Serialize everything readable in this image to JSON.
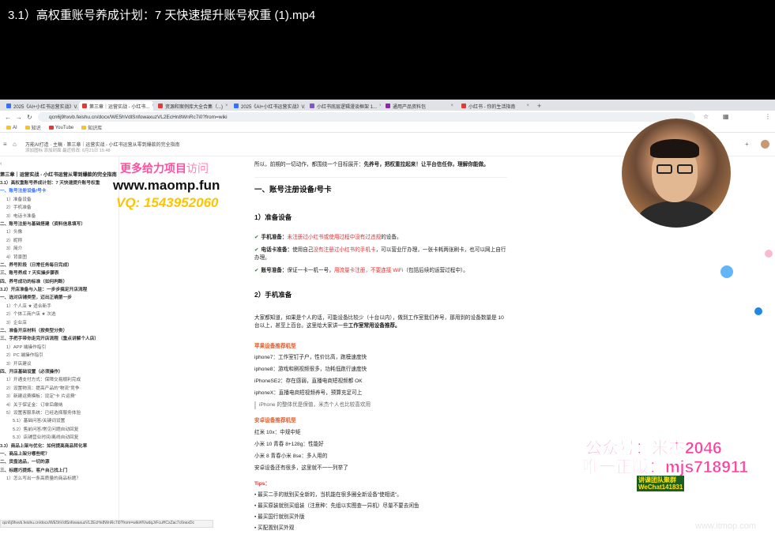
{
  "video_title": "3.1）高权重账号养成计划：7 天快速提升账号权重 (1).mp4",
  "tabs": [
    {
      "label": "2025《AI+小红书运营实战》V..."
    },
    {
      "label": "第三章｜运营实战 - 小红书..."
    },
    {
      "label": "资源和案例库大全合集（...)"
    },
    {
      "label": "2025《AI+小红书运营实战》V..."
    },
    {
      "label": "小红书底层逻辑漫谈框架 1..."
    },
    {
      "label": "通用产品资料包"
    },
    {
      "label": "小红书 - 你的生活指南"
    }
  ],
  "url": "qcn6j9hxvb.feishu.cn/docx/WE5hVdlSnfowaxuzVL2EcHn8WnRc7i0?from=wiki",
  "bookmarks": [
    "AI",
    "知识",
    "YouTube",
    "知识库"
  ],
  "doc_header": {
    "breadcrumb": "万能AI打造  ·  主稿  ·  第三章｜运营实战 - 小红书运营从零到爆款的完全指南",
    "meta": "添加图标  添加封面  最近修改: 6月21日 15:48"
  },
  "toc": {
    "heading": "第三章｜运营实战 - 小红书运营从零到爆款的完全指南",
    "items": [
      {
        "t": "3.1）高权重账号养成计划：7 天快速提升账号权重",
        "l": 1
      },
      {
        "t": "一、账号注册设备/号卡",
        "l": 1,
        "cur": true
      },
      {
        "t": "1）准备设备",
        "l": 2
      },
      {
        "t": "2）手机准备",
        "l": 2
      },
      {
        "t": "3）电话卡准备",
        "l": 2
      },
      {
        "t": "二、账号注册与基础搭建（资料信息填写）",
        "l": 1
      },
      {
        "t": "1）头像",
        "l": 2
      },
      {
        "t": "2）昵称",
        "l": 2
      },
      {
        "t": "3）简介",
        "l": 2
      },
      {
        "t": "4）背景图",
        "l": 2
      },
      {
        "t": "二、养号阶段（日常任务每日完成）",
        "l": 1
      },
      {
        "t": "三、账号养成 7 天实操步骤表",
        "l": 1
      },
      {
        "t": "四、养号成功的标准（如何判断）",
        "l": 1
      },
      {
        "t": "3.2）开店准备与入驻：一步步搞定开店流程",
        "l": 1
      },
      {
        "t": "一、选对店铺类型，迈出正确第一步",
        "l": 1
      },
      {
        "t": "1）个人店 ★ 适合新手",
        "l": 2
      },
      {
        "t": "2）个体工商户店 ★ 次选",
        "l": 2
      },
      {
        "t": "3）企业店",
        "l": 2
      },
      {
        "t": "二、准备开店材料（按类型分类）",
        "l": 1
      },
      {
        "t": "三、手把手带你走完开店流程（重点讲解个人店）",
        "l": 1
      },
      {
        "t": "1）APP 端操作指引",
        "l": 2
      },
      {
        "t": "2）PC 端操作指引",
        "l": 2
      },
      {
        "t": "3）开店建议",
        "l": 2
      },
      {
        "t": "四、开店基础设置（必须操作）",
        "l": 1
      },
      {
        "t": "1）开通支付方式：保障交易顺利完成",
        "l": 2
      },
      {
        "t": "2）设置物流：提高产品的\"物流\"竞争",
        "l": 2
      },
      {
        "t": "3）新建运费模板：设定\"卡 片运费\"",
        "l": 2
      },
      {
        "t": "4）关于保证金：订单后缴纳",
        "l": 2
      },
      {
        "t": "5）设置客服系统：已经选择服务体验",
        "l": 2
      },
      {
        "t": "5.1）基础问答/关键词设置",
        "l": 3
      },
      {
        "t": "5.2）售前问答/常见问题自动回复",
        "l": 3
      },
      {
        "t": "5.3）店铺营业时间/离线自动回复",
        "l": 3
      },
      {
        "t": "3.3）商品上架与优化：如何提高商品转化率",
        "l": 1
      },
      {
        "t": "一、商品上架分哪些呢？",
        "l": 1
      },
      {
        "t": "二、货盘选品，一切的源",
        "l": 1
      },
      {
        "t": "三、标题巧提炼，客户自己找上门",
        "l": 1
      },
      {
        "t": "1）怎么写出一条高质量的商品标题？",
        "l": 2
      }
    ]
  },
  "watermark_left": {
    "line1a": "更多给力项目",
    "line1b": "访问",
    "line2": "www.maomp.fun",
    "line3": "VQ: 1543952060"
  },
  "content": {
    "intro": "所以，前期的一切动作，都围绕一个目标展开：",
    "intro_b": "先养号，把权重拉起来！让平台信任你，理解你能做。",
    "h1": "一、账号注册设备/号卡",
    "h2a": "1）准备设备",
    "b1k": "手机准备：",
    "b1r": "未注册过小红书或使用过程中没有过违规",
    "b1e": "的设备。",
    "b2k": "电话卡准备：",
    "b2a": "使用自己",
    "b2r": "没有注册过小红书的手机卡",
    "b2e": "，可以营业厅办理，一张卡耗两张刷卡，也可以网上自行",
    "b2f": "办理。",
    "b3k": "账号准备：",
    "b3a": "保证一卡一机一号，",
    "b3r": "用流量卡注册，不要连接 WiFi",
    "b3e": "（包括后续的运营过程中）。",
    "h2b": "2）手机准备",
    "p1": "大家都知道，如果是个人的话，可能设备比较少（十台以内），做到工作室我们养号，那用到的设备数量是 10",
    "p2a": "台以上，甚至上百台。这里给大家讲一些",
    "p2b": "工作室常用设备推荐。",
    "sh1": "苹果设备推荐机型",
    "ios": [
      "iphone7：工作室钉子户，性价比高，跑模速度快",
      "iphone8：游戏和刷视频很多，功耗低跑行速度快",
      "iPhoneSE2：存在感弱，直播电商短视频都 OK",
      "iphoneX：直播电商短视频养号，预算充足可上"
    ],
    "quote": "iPhone 的整体优是保值，米杰个人也比较喜欢用",
    "sh2": "安卓设备推荐机型",
    "android": [
      "红米 10x：中规中矩",
      "小米 10 青春 8+128g：性能好",
      "小米 8 青春小米 8se：多人用的",
      "安卓设备还有很多，这里就不一一列举了"
    ],
    "sh3": "Tips：",
    "tips": [
      "最买二手的就别买全新的，当机能在很多圈全新设备\"使相说\"。",
      "最买原装就别买组装（注意种：先组以实图查一异机）尽量不要去闲鱼",
      "最买国行就别买外版",
      "买配置别买外观",
      "买最新最好价钱"
    ]
  },
  "status_url": "qcn6j9hxvb.feishu.cn/docx/WE5hVdlSnfowaxuzVL2EcHn8WnRc7i0?from=wiki#fVwdqJrFcuHCxZac7c6nexDc",
  "overlay_right": {
    "line1": "公众号：米杰2046",
    "line2": "唯一正版：mjs718911",
    "badge1": "讲课团队聚群",
    "badge2": "WeChat141831"
  },
  "site_watermark": "www.itmop.com",
  "colors": {
    "accent": "#3370ff",
    "pink": "#ff3ea0",
    "yellow": "#ffc400",
    "red": "#e03030"
  }
}
